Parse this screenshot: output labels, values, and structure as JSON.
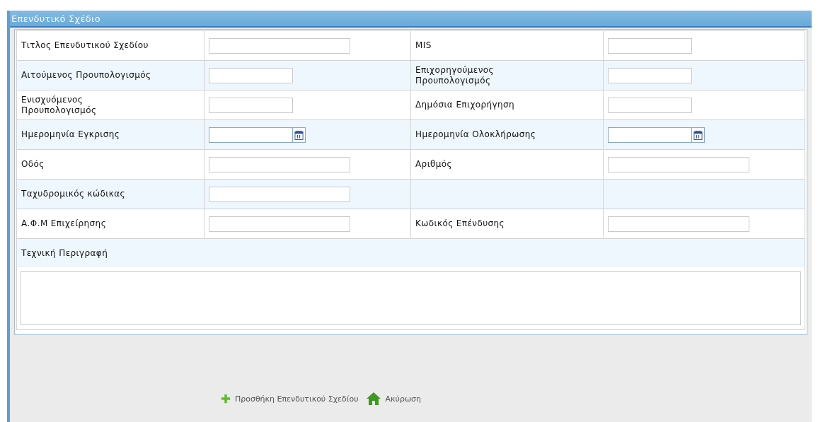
{
  "panel": {
    "title": "Επενδυτικό Σχέδιο"
  },
  "rows": [
    {
      "left": {
        "label": "Τιτλος Επενδυτικού Σχεδίου",
        "kind": "wide"
      },
      "right": {
        "label": "MIS",
        "kind": "short"
      }
    },
    {
      "left": {
        "label": "Αιτούμενος Προυπολογισμός",
        "kind": "short"
      },
      "right": {
        "label": "Επιχορηγούμενος Προυπολογισμός",
        "kind": "short"
      }
    },
    {
      "left": {
        "label": "Ενισχυόμενος Προυπολογισμός",
        "kind": "short"
      },
      "right": {
        "label": "Δημόσια Επιχορήγηση",
        "kind": "short"
      }
    },
    {
      "left": {
        "label": "Ημερομηνία Εγκρισης",
        "kind": "date"
      },
      "right": {
        "label": "Ημερομηνία Ολοκλήρωσης",
        "kind": "date"
      }
    },
    {
      "left": {
        "label": "Οδός",
        "kind": "wide"
      },
      "right": {
        "label": "Αριθμός",
        "kind": "wide"
      }
    },
    {
      "left": {
        "label": "Ταχυδρομικός κώδικας",
        "kind": "wide"
      }
    },
    {
      "left": {
        "label": "Α.Φ.Μ Επιχείρησης",
        "kind": "wide"
      },
      "right": {
        "label": "Κωδικός Επένδυσης",
        "kind": "wide"
      }
    }
  ],
  "description": {
    "label": "Τεχνική Περιγραφή"
  },
  "actions": [
    {
      "label": "Προσθήκη Επενδυτικού Σχεδίου",
      "kind": "add"
    },
    {
      "label": "Ακύρωση",
      "kind": "home"
    }
  ]
}
